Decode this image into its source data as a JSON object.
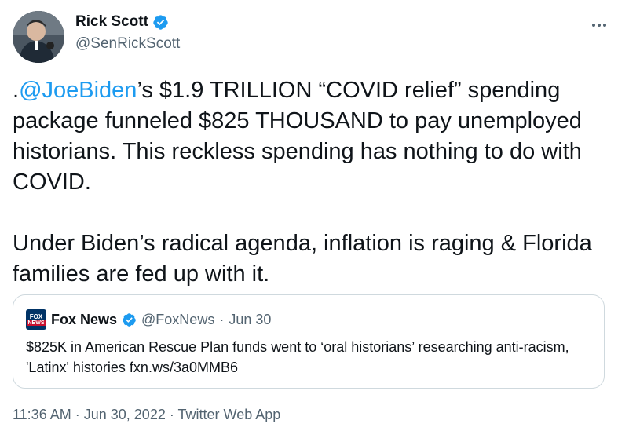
{
  "author": {
    "name": "Rick Scott",
    "handle": "@SenRickScott",
    "avatar_icon": "profile-photo"
  },
  "more_icon": "more-horizontal-icon",
  "tweet": {
    "lead": ".",
    "mention": "@JoeBiden",
    "paragraph1_rest": "’s $1.9 TRILLION “COVID relief” spending package funneled $825 THOUSAND to pay unemployed historians. This reckless spending has nothing to do with COVID.",
    "paragraph2": "Under Biden’s radical agenda, inflation is raging & Florida families are fed up with it."
  },
  "quote": {
    "name": "Fox News",
    "handle": "@FoxNews",
    "separator": "·",
    "date": "Jun 30",
    "avatar_logo": [
      "FOX",
      "NEWS"
    ],
    "text": "$825K in American Rescue Plan funds went to ‘oral historians’ researching anti-racism, 'Latinx' histories fxn.ws/3a0MMB6"
  },
  "meta": {
    "time": "11:36 AM",
    "sep1": "·",
    "date": "Jun 30, 2022",
    "sep2": "·",
    "app": "Twitter Web App"
  },
  "colors": {
    "link": "#1d9bf0",
    "verified": "#1d9bf0",
    "secondary_text": "#536471",
    "border": "#cfd9de"
  }
}
